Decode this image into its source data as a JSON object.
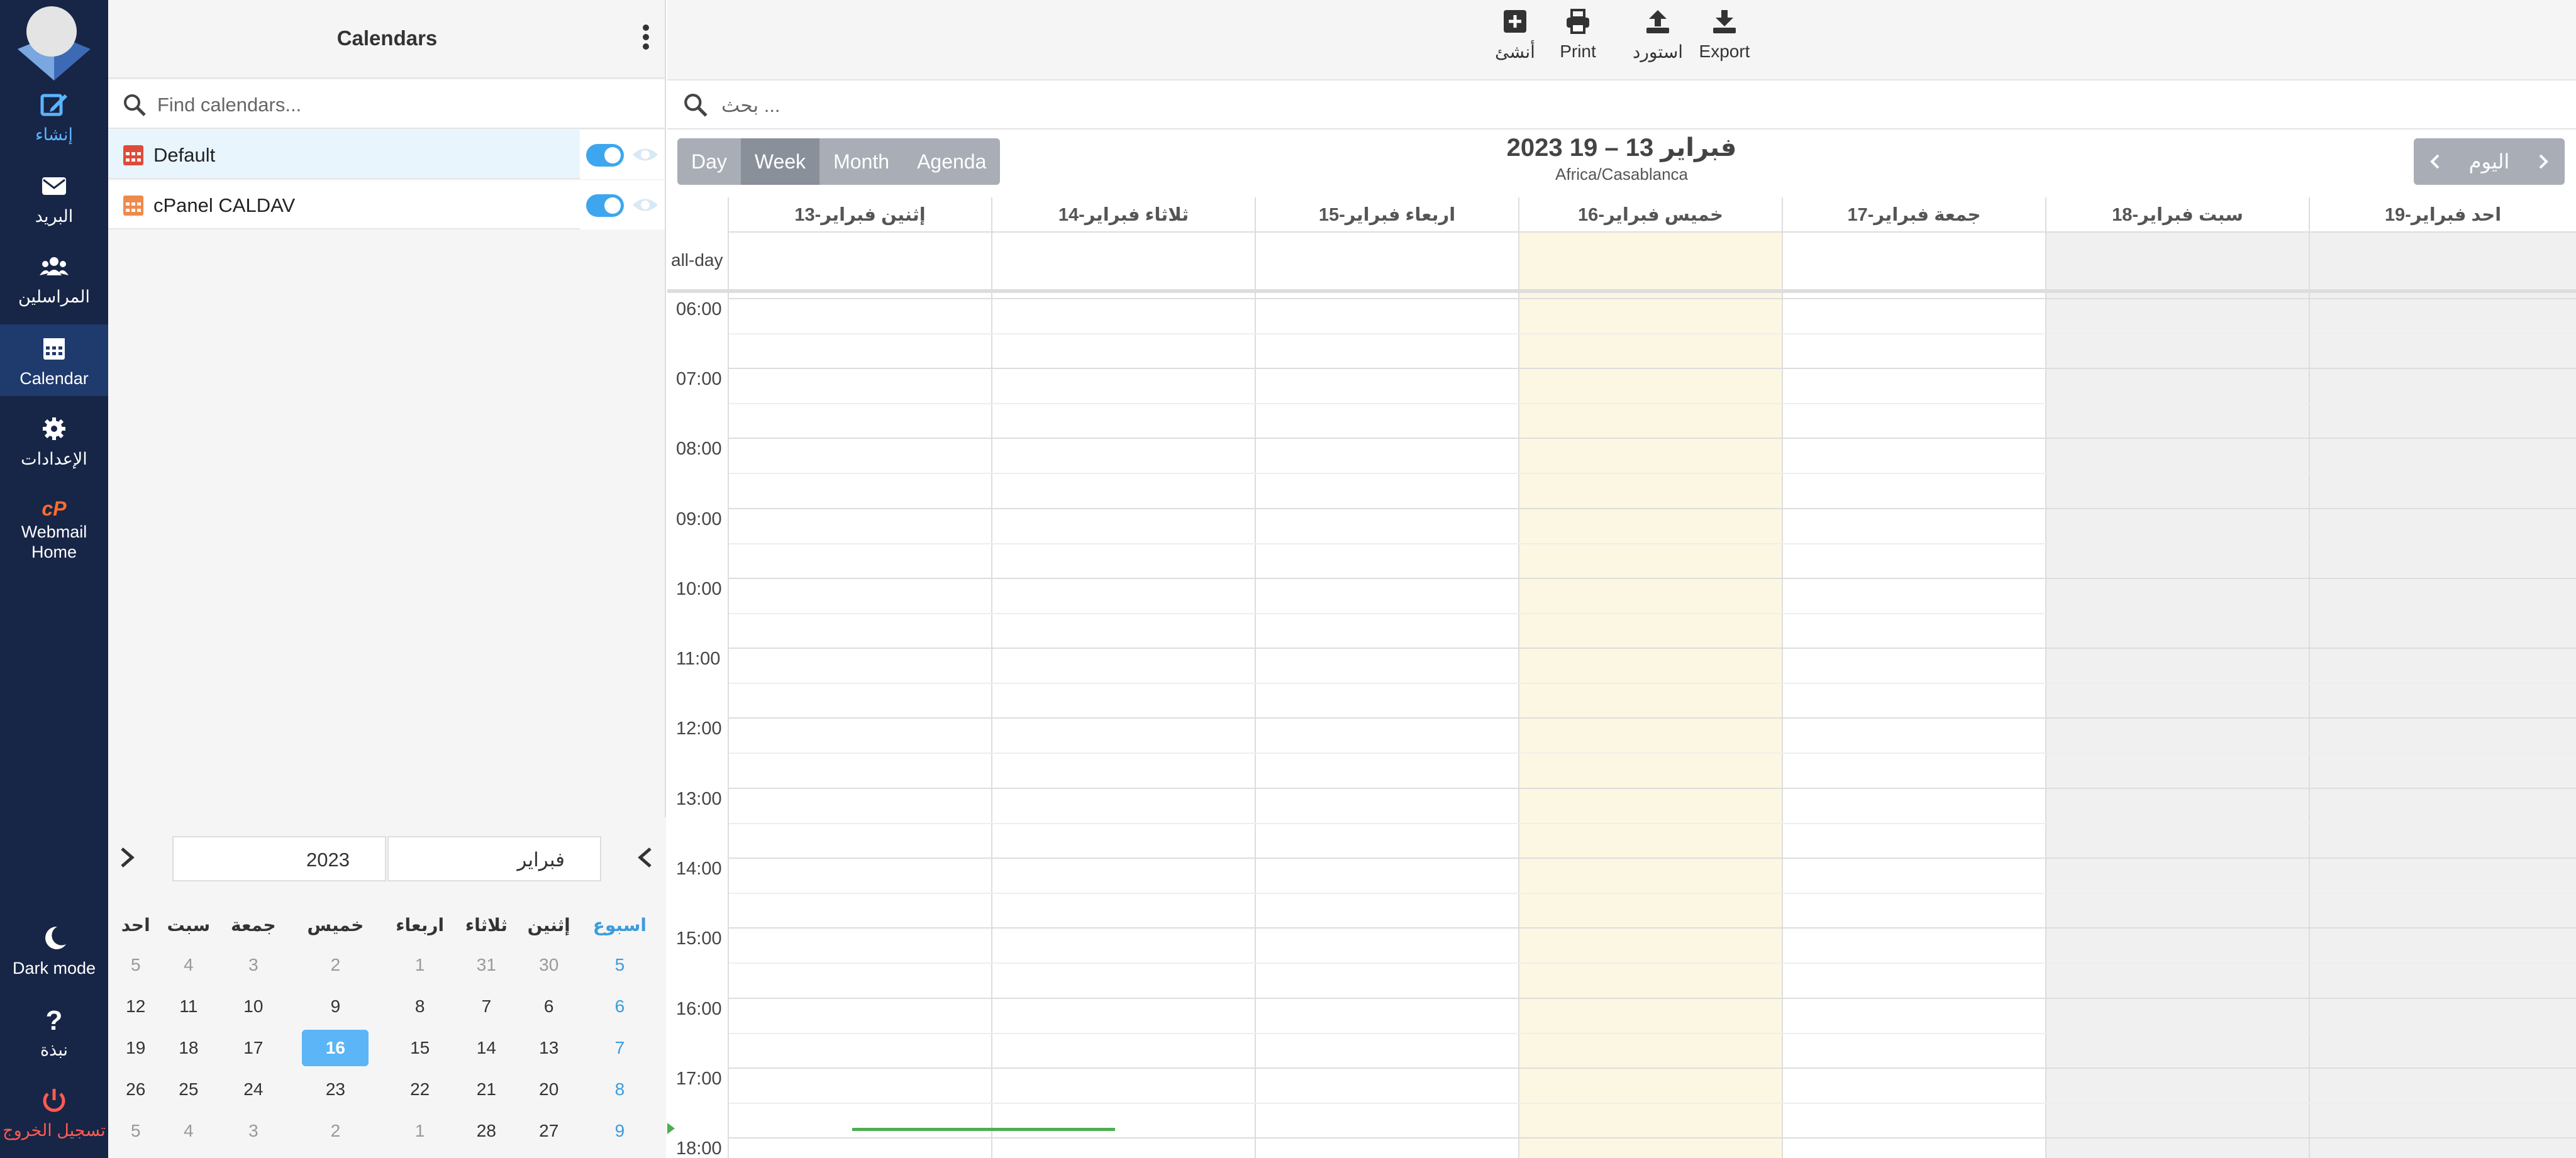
{
  "nav": {
    "items": [
      {
        "label": "إنشاء",
        "icon": "compose-icon"
      },
      {
        "label": "البريد",
        "icon": "mail-icon"
      },
      {
        "label": "المراسلين",
        "icon": "contacts-icon"
      },
      {
        "label": "Calendar",
        "icon": "calendar-icon"
      },
      {
        "label": "الإعدادات",
        "icon": "gear-icon"
      },
      {
        "label": "Webmail Home",
        "icon": "cpanel-icon"
      },
      {
        "label": "Dark mode",
        "icon": "moon-icon"
      },
      {
        "label": "نبذة",
        "icon": "help-icon"
      },
      {
        "label": "تسجيل الخروج",
        "icon": "power-icon"
      }
    ]
  },
  "sidebar": {
    "title": "Calendars",
    "search_placeholder": "Find calendars...",
    "calendars": [
      {
        "name": "Default",
        "color": "#e04a3a",
        "enabled": true
      },
      {
        "name": "cPanel CALDAV",
        "color": "#f08a4b",
        "enabled": true
      }
    ]
  },
  "mini_calendar": {
    "month": "فبراير",
    "year": "2023",
    "headers": [
      "احد",
      "سبت",
      "جمعة",
      "خميس",
      "اربعاء",
      "ثلاثاء",
      "إثنين",
      "اسبوع"
    ],
    "rows": [
      [
        "5",
        "4",
        "3",
        "2",
        "1",
        "31",
        "30",
        "5"
      ],
      [
        "12",
        "11",
        "10",
        "9",
        "8",
        "7",
        "6",
        "6"
      ],
      [
        "19",
        "18",
        "17",
        "16",
        "15",
        "14",
        "13",
        "7"
      ],
      [
        "26",
        "25",
        "24",
        "23",
        "22",
        "21",
        "20",
        "8"
      ],
      [
        "5",
        "4",
        "3",
        "2",
        "1",
        "28",
        "27",
        "9"
      ]
    ]
  },
  "toolbar": {
    "create": "أنشئ",
    "print": "Print",
    "import": "استورد",
    "export": "Export"
  },
  "search": {
    "placeholder": "بحث ..."
  },
  "views": {
    "day": "Day",
    "week": "Week",
    "month": "Month",
    "agenda": "Agenda",
    "active": "Week"
  },
  "range": {
    "title": "فبراير 13 – 19 2023",
    "timezone": "Africa/Casablanca"
  },
  "nav_buttons": {
    "today": "اليوم"
  },
  "week": {
    "all_day_label": "all-day",
    "days": [
      {
        "label": "إثنين فبراير-13",
        "type": "normal"
      },
      {
        "label": "ثلاثاء فبراير-14",
        "type": "normal"
      },
      {
        "label": "اربعاء فبراير-15",
        "type": "normal"
      },
      {
        "label": "خميس فبراير-16",
        "type": "today"
      },
      {
        "label": "جمعة فبراير-17",
        "type": "normal"
      },
      {
        "label": "سبت فبراير-18",
        "type": "weekend"
      },
      {
        "label": "احد فبراير-19",
        "type": "weekend"
      }
    ],
    "hours": [
      "06:00",
      "07:00",
      "08:00",
      "09:00",
      "10:00",
      "11:00",
      "12:00",
      "13:00",
      "14:00",
      "15:00",
      "16:00",
      "17:00",
      "18:00"
    ]
  },
  "colors": {
    "nav_bg": "#172546",
    "accent": "#3ea6ee",
    "today_col": "#fcf7e2",
    "now_line": "#4caf50"
  }
}
